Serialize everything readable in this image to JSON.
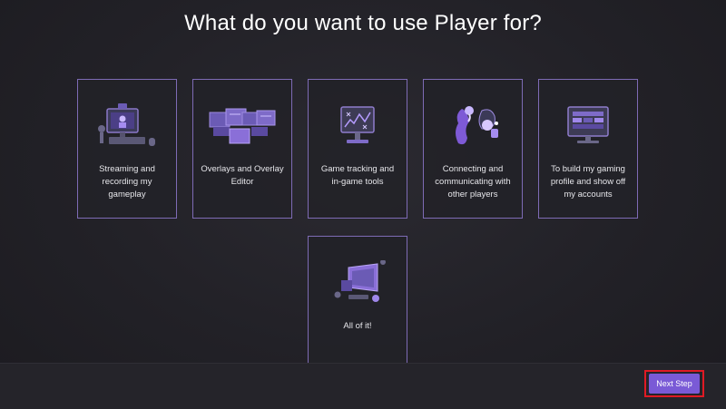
{
  "page": {
    "title": "What do you want to use Player for?"
  },
  "cards": [
    {
      "label": "Streaming and recording my gameplay",
      "icon": "streaming-setup-icon"
    },
    {
      "label": "Overlays and Overlay Editor",
      "icon": "overlay-windows-icon"
    },
    {
      "label": "Game tracking and in-game tools",
      "icon": "tracking-monitor-icon"
    },
    {
      "label": "Connecting and communicating with other players",
      "icon": "players-chat-icon"
    },
    {
      "label": "To build my gaming profile and show off my accounts",
      "icon": "profile-monitor-icon"
    },
    {
      "label": "All of it!",
      "icon": "all-devices-icon"
    }
  ],
  "footer": {
    "next_label": "Next Step"
  },
  "colors": {
    "accent": "#7a5ad6",
    "card_border": "#7e6bb5",
    "highlight": "#e01a24"
  }
}
